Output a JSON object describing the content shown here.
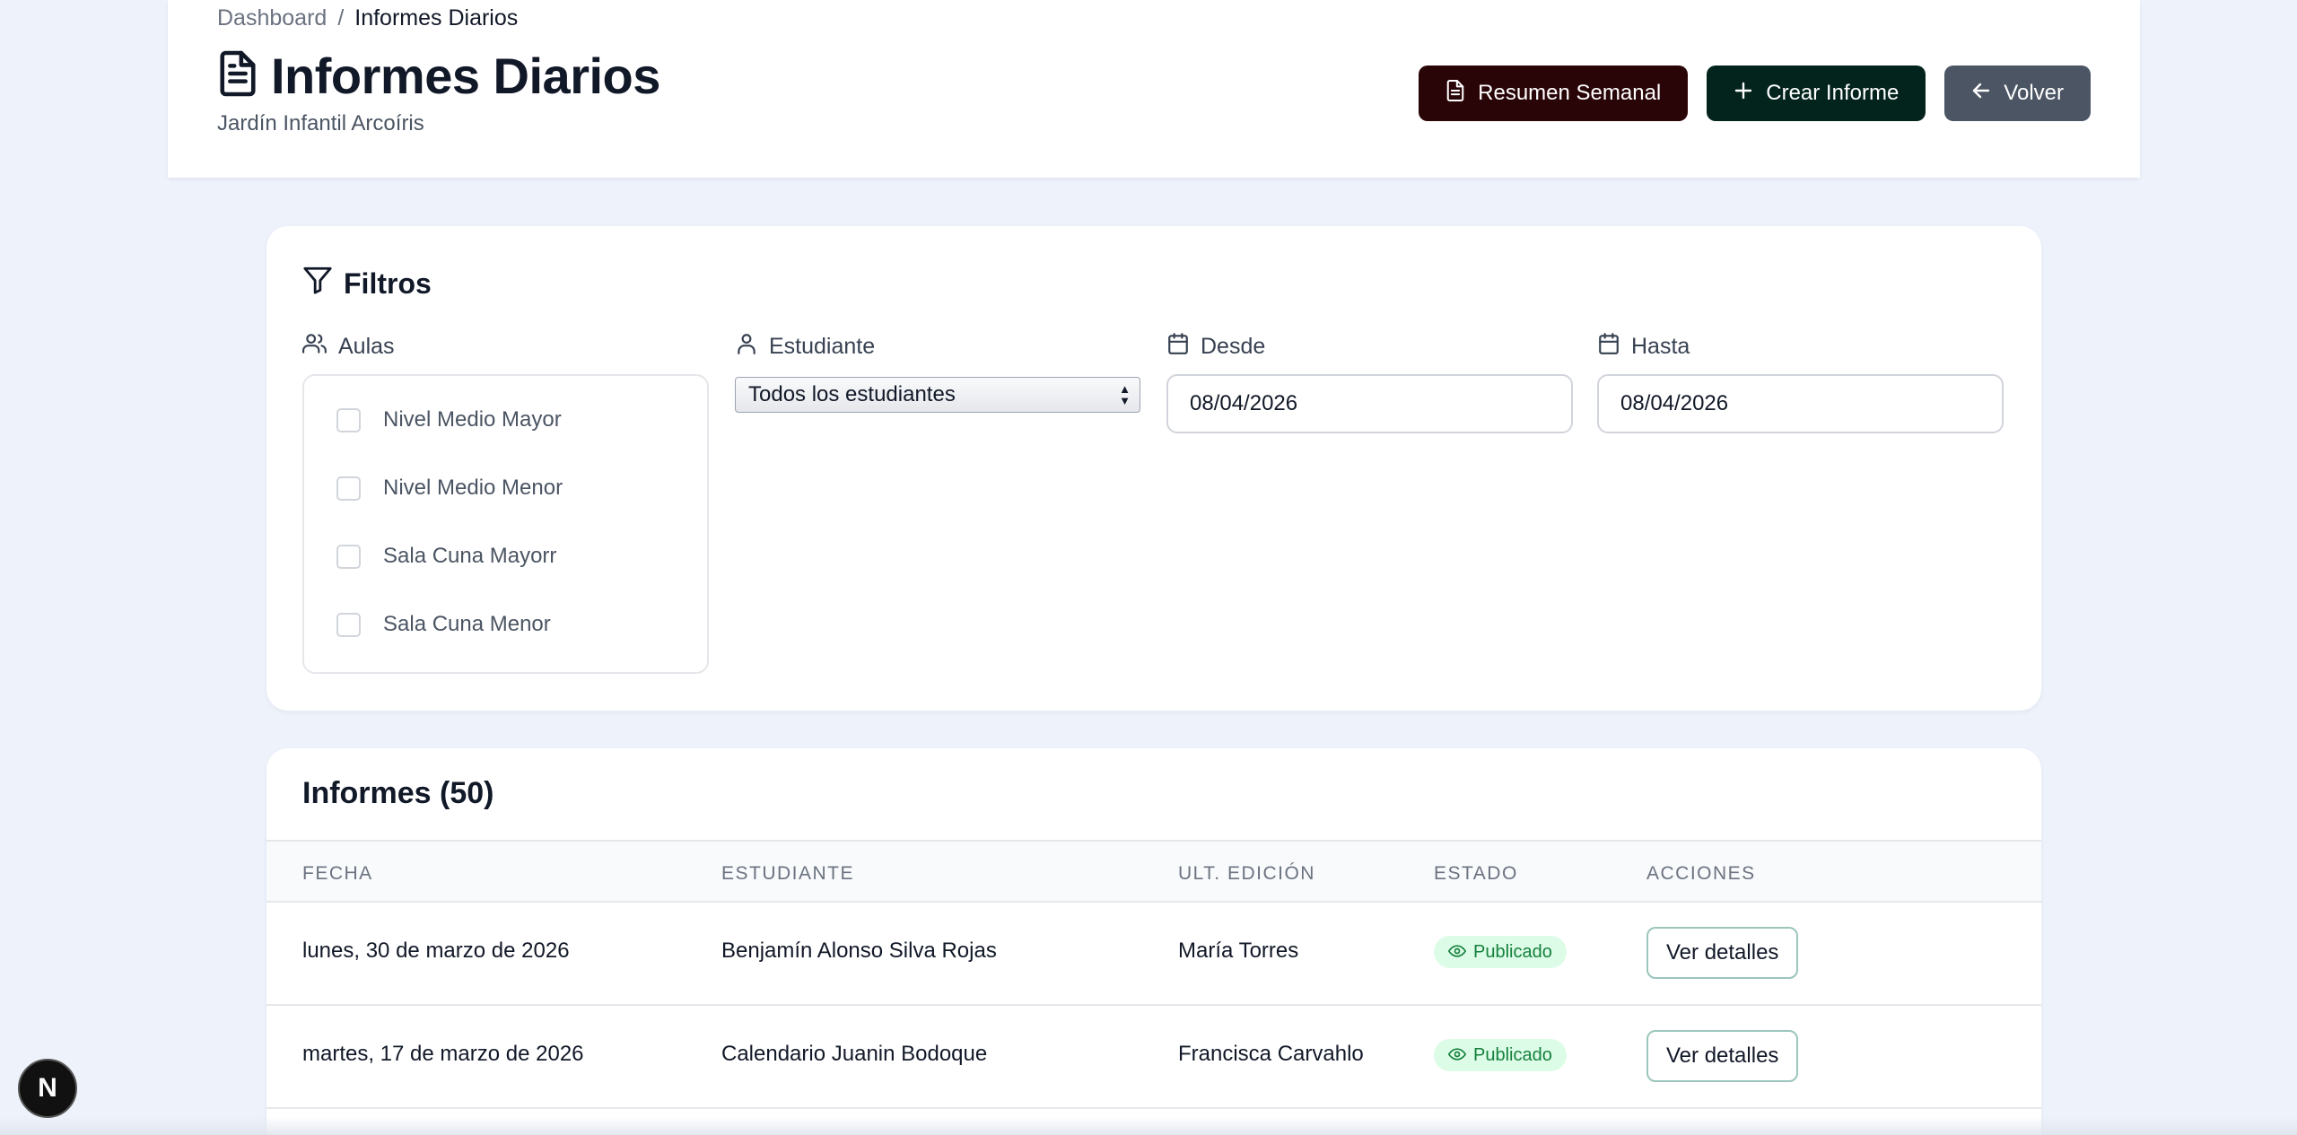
{
  "breadcrumb": {
    "root": "Dashboard",
    "separator": "/",
    "current": "Informes Diarios"
  },
  "header": {
    "title": "Informes Diarios",
    "subtitle": "Jardín Infantil Arcoíris",
    "icon": "document-icon",
    "actions": {
      "weekly_summary": "Resumen Semanal",
      "create_report": "Crear Informe",
      "back": "Volver"
    }
  },
  "filters": {
    "title": "Filtros",
    "classrooms": {
      "label": "Aulas",
      "options": [
        {
          "label": "Nivel Medio Mayor",
          "checked": false
        },
        {
          "label": "Nivel Medio Menor",
          "checked": false
        },
        {
          "label": "Sala Cuna Mayorr",
          "checked": false
        },
        {
          "label": "Sala Cuna Menor",
          "checked": false
        }
      ]
    },
    "student": {
      "label": "Estudiante",
      "selected": "Todos los estudiantes"
    },
    "from": {
      "label": "Desde",
      "value": "08/04/2026"
    },
    "to": {
      "label": "Hasta",
      "value": "08/04/2026"
    }
  },
  "reports": {
    "title": "Informes (50)",
    "columns": [
      "FECHA",
      "ESTUDIANTE",
      "ULT. EDICIÓN",
      "ESTADO",
      "ACCIONES"
    ],
    "rows": [
      {
        "date": "lunes, 30 de marzo de 2026",
        "student": "Benjamín Alonso Silva Rojas",
        "last_edit": "María Torres",
        "status": "Publicado",
        "action": "Ver detalles"
      },
      {
        "date": "martes, 17 de marzo de 2026",
        "student": "Calendario Juanin Bodoque",
        "last_edit": "Francisca Carvahlo",
        "status": "Publicado",
        "action": "Ver detalles"
      }
    ]
  },
  "dev_badge": "N",
  "colors": {
    "background": "#eef2fb",
    "weekly_button": "#2a0508",
    "create_button": "#03241c",
    "back_button": "#4b5563",
    "status_badge_bg": "#dcfce7",
    "status_badge_text": "#15803d"
  }
}
